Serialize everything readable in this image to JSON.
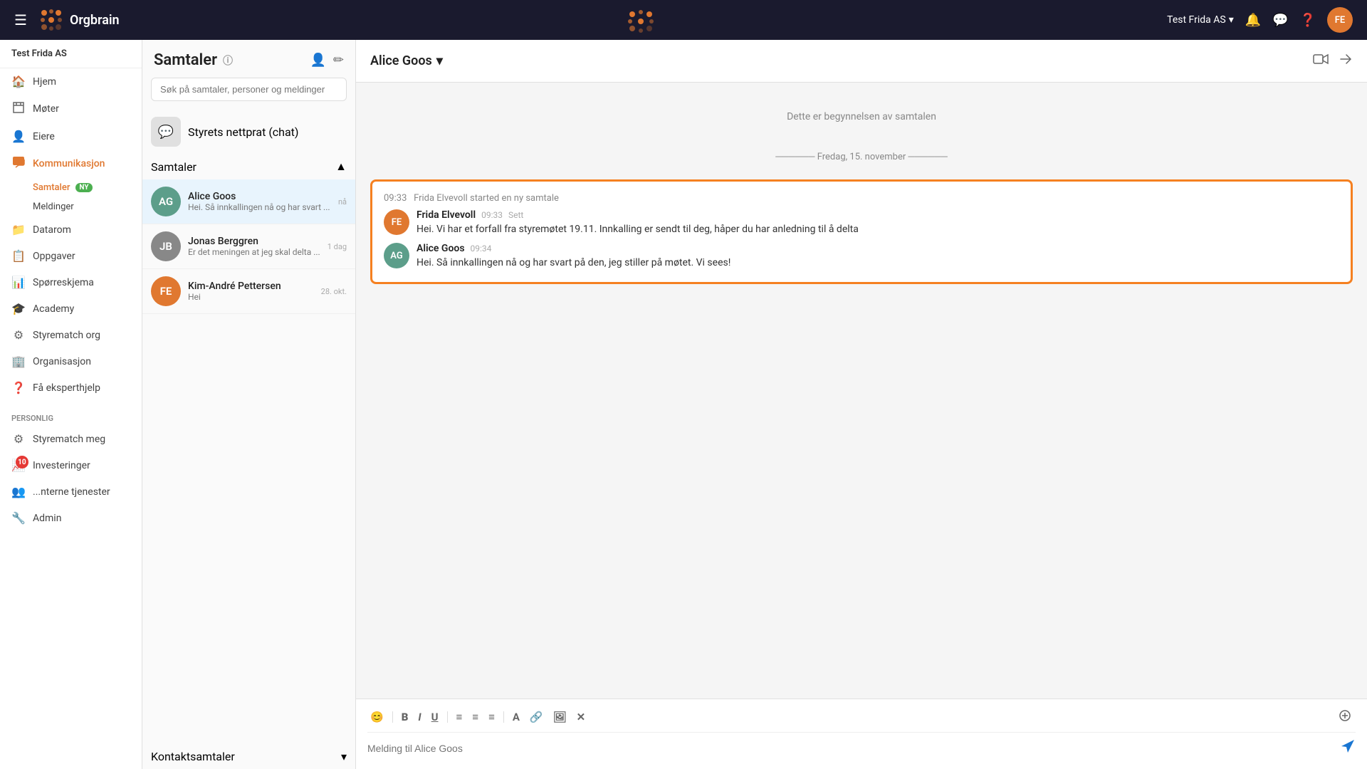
{
  "topbar": {
    "menu_icon": "☰",
    "logo_text": "Orgbrain",
    "org_name": "Test Frida AS",
    "org_dropdown": "▾",
    "user_initials": "FE"
  },
  "sidebar": {
    "org_label": "Test Frida AS",
    "items": [
      {
        "id": "hjem",
        "label": "Hjem",
        "icon": "🏠"
      },
      {
        "id": "moter",
        "label": "Møter",
        "icon": "📐"
      },
      {
        "id": "eiere",
        "label": "Eiere",
        "icon": "👤"
      },
      {
        "id": "kommunikasjon",
        "label": "Kommunikasjon",
        "icon": "💬",
        "active": true
      },
      {
        "id": "datarom",
        "label": "Datarom",
        "icon": "📁"
      },
      {
        "id": "oppgaver",
        "label": "Oppgaver",
        "icon": "📋"
      },
      {
        "id": "sporreskjema",
        "label": "Spørreskjema",
        "icon": "📊"
      },
      {
        "id": "academy",
        "label": "Academy",
        "icon": "🎓"
      },
      {
        "id": "styrematch",
        "label": "Styrematch org",
        "icon": "⚙"
      },
      {
        "id": "organisasjon",
        "label": "Organisasjon",
        "icon": "🏢"
      },
      {
        "id": "eksperthjelp",
        "label": "Få eksperthjelp",
        "icon": "❓"
      }
    ],
    "sub_items": [
      {
        "id": "samtaler",
        "label": "Samtaler",
        "badge": "NY",
        "active": true
      },
      {
        "id": "meldinger",
        "label": "Meldinger"
      }
    ],
    "personal_section": "Personlig",
    "personal_items": [
      {
        "id": "styrematch_meg",
        "label": "Styrematch meg",
        "icon": "⚙"
      },
      {
        "id": "investeringer",
        "label": "Investeringer",
        "icon": "📈",
        "notification": "10"
      },
      {
        "id": "interne_tjenester",
        "label": "...nterne tjenester",
        "icon": "👥"
      },
      {
        "id": "admin",
        "label": "Admin",
        "icon": "🔧"
      }
    ]
  },
  "conversations": {
    "title": "Samtaler",
    "search_placeholder": "Søk på samtaler, personer og meldinger",
    "channel": {
      "icon": "💬",
      "name": "Styrets nettprat (chat)"
    },
    "section_label": "Samtaler",
    "items": [
      {
        "id": "alice",
        "name": "Alice Goos",
        "preview": "Hei. Så innkallingen nå og har svart ...",
        "time": "nå",
        "avatar_color": "#5c9e8a",
        "initials": "AG",
        "active": true
      },
      {
        "id": "jonas",
        "name": "Jonas Berggren",
        "preview": "Er det meningen at jeg skal delta ...",
        "time": "1 dag",
        "avatar_color": "#555",
        "initials": "JB",
        "active": false
      },
      {
        "id": "kim",
        "name": "Kim-André Pettersen",
        "preview": "Hei",
        "time": "28. okt.",
        "avatar_color": "#e07830",
        "initials": "FE",
        "active": false
      }
    ],
    "contact_section": "Kontaktsamtaler"
  },
  "chat": {
    "contact_name": "Alice Goos",
    "dropdown_icon": "▾",
    "start_text": "Dette er begynnelsen av samtalen",
    "date_divider": "Fredag, 15. november",
    "system_msg_time": "09:33",
    "system_msg_text": "Frida Elvevoll started en ny samtale",
    "messages": [
      {
        "id": "msg1",
        "sender": "Frida Elvevoll",
        "time": "09:33",
        "status": "Sett",
        "text": "Hei. Vi har et forfall fra styremøtet 19.11. Innkalling er sendt til deg, håper du har anledning til å delta",
        "avatar_color": "#e07830",
        "initials": "FE"
      },
      {
        "id": "msg2",
        "sender": "Alice Goos",
        "time": "09:34",
        "status": "",
        "text": "Hei. Så innkallingen nå og har svart på den, jeg stiller på møtet. Vi sees!",
        "avatar_color": "#5c9e8a",
        "initials": "AG"
      }
    ],
    "input_placeholder": "Melding til Alice Goos",
    "toolbar_buttons": [
      "😊",
      "B",
      "I",
      "U",
      "≡",
      "≡",
      "≡",
      "A",
      "🔗",
      "🖼",
      "✕"
    ]
  }
}
